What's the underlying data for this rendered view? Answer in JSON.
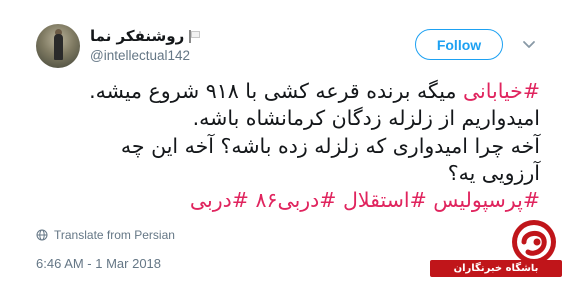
{
  "tweet": {
    "user": {
      "display_name": "روشنفکر نما",
      "handle": "@intellectual142",
      "flag_icon": "white-flag-icon"
    },
    "follow_label": "Follow",
    "menu_icon": "chevron-down-icon",
    "text": {
      "hashtag_1": "#خیابانی",
      "line_1_rest": " میگه برنده قرعه کشی با ۹۱۸ شروع میشه.",
      "line_2": "امیدواریم از زلزله زدگان کرمانشاه باشه.",
      "line_3": "آخه چرا امیدواری که زلزله زده باشه؟ آخه این چه",
      "line_4": "آرزویی یه؟",
      "hashtag_2": "#پرسپولیس",
      "hashtag_3": "#استقلال",
      "hashtag_4": "#دربی۸۶",
      "hashtag_5": "#دربی"
    },
    "translate_label": "Translate from Persian",
    "timestamp": "6:46 AM - 1 Mar 2018"
  },
  "watermark": {
    "text": "باشگاه خبرنگاران"
  },
  "colors": {
    "hashtag": "#e0245e",
    "accent": "#1da1f2",
    "secondary_text": "#657786",
    "watermark_red": "#c0151a"
  }
}
